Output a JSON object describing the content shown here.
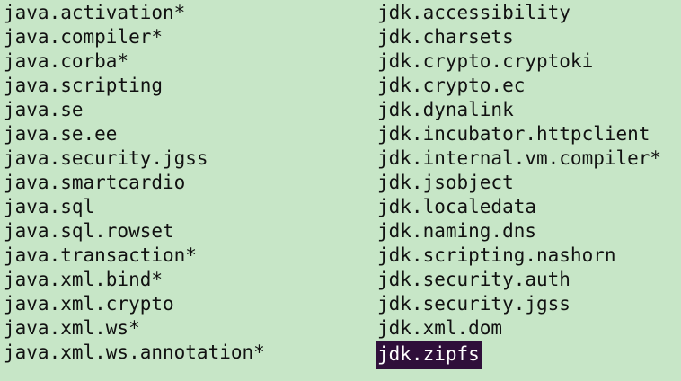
{
  "terminal": {
    "colors": {
      "background": "#c7e6c7",
      "text": "#111111",
      "selection_background": "#2f0f3a",
      "selection_text": "#ffffff"
    },
    "left_column": [
      "java.activation*",
      "java.compiler*",
      "java.corba*",
      "java.scripting",
      "java.se",
      "java.se.ee",
      "java.security.jgss",
      "java.smartcardio",
      "java.sql",
      "java.sql.rowset",
      "java.transaction*",
      "java.xml.bind*",
      "java.xml.crypto",
      "java.xml.ws*",
      "java.xml.ws.annotation*"
    ],
    "right_column": [
      "jdk.accessibility",
      "jdk.charsets",
      "jdk.crypto.cryptoki",
      "jdk.crypto.ec",
      "jdk.dynalink",
      "jdk.incubator.httpclient",
      "jdk.internal.vm.compiler*",
      "jdk.jsobject",
      "jdk.localedata",
      "jdk.naming.dns",
      "jdk.scripting.nashorn",
      "jdk.security.auth",
      "jdk.security.jgss",
      "jdk.xml.dom",
      "jdk.zipfs"
    ]
  }
}
